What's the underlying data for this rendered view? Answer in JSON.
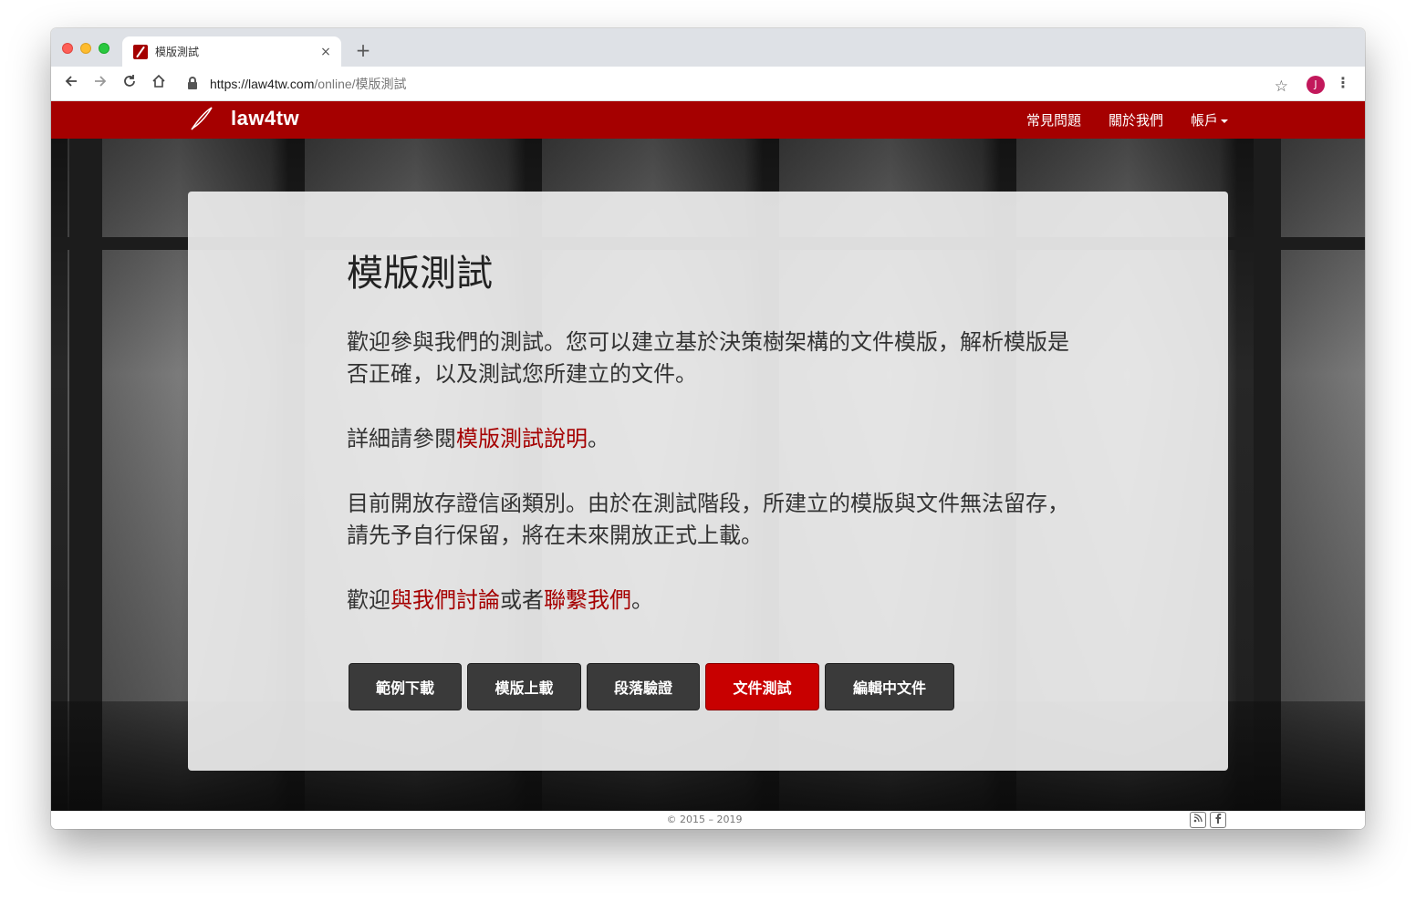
{
  "browser": {
    "tab_title": "模版測試",
    "tab_close": "×",
    "new_tab": "+",
    "url_host": "https://law4tw.com",
    "url_path": "/online/模版測試",
    "profile_initial": "J",
    "icons": [
      "back-icon",
      "forward-icon",
      "reload-icon",
      "home-icon",
      "lock-icon",
      "star-icon",
      "menu-icon"
    ]
  },
  "navbar": {
    "brand": "law4tw",
    "links": [
      "常見問題",
      "關於我們",
      "帳戶"
    ],
    "color": "#a50000"
  },
  "card": {
    "title": "模版測試",
    "intro": "歡迎參與我們的測試。您可以建立基於決策樹架構的文件模版，解析模版是否正確，以及測試您所建立的文件。",
    "detail_prefix": "詳細請參閱",
    "detail_link": "模版測試說明",
    "detail_suffix": "。",
    "notice": "目前開放存證信函類別。由於在測試階段，所建立的模版與文件無法留存，請先予自行保留，將在未來開放正式上載。",
    "contact_prefix": "歡迎",
    "contact_link1": "與我們討論",
    "contact_mid": "或者",
    "contact_link2": "聯繫我們",
    "contact_suffix": "。"
  },
  "buttons": [
    {
      "label": "範例下載",
      "active": false
    },
    {
      "label": "模版上載",
      "active": false
    },
    {
      "label": "段落驗證",
      "active": false
    },
    {
      "label": "文件測試",
      "active": true
    },
    {
      "label": "編輯中文件",
      "active": false
    }
  ],
  "footer": {
    "copyright": "© 2015 – 2019"
  }
}
